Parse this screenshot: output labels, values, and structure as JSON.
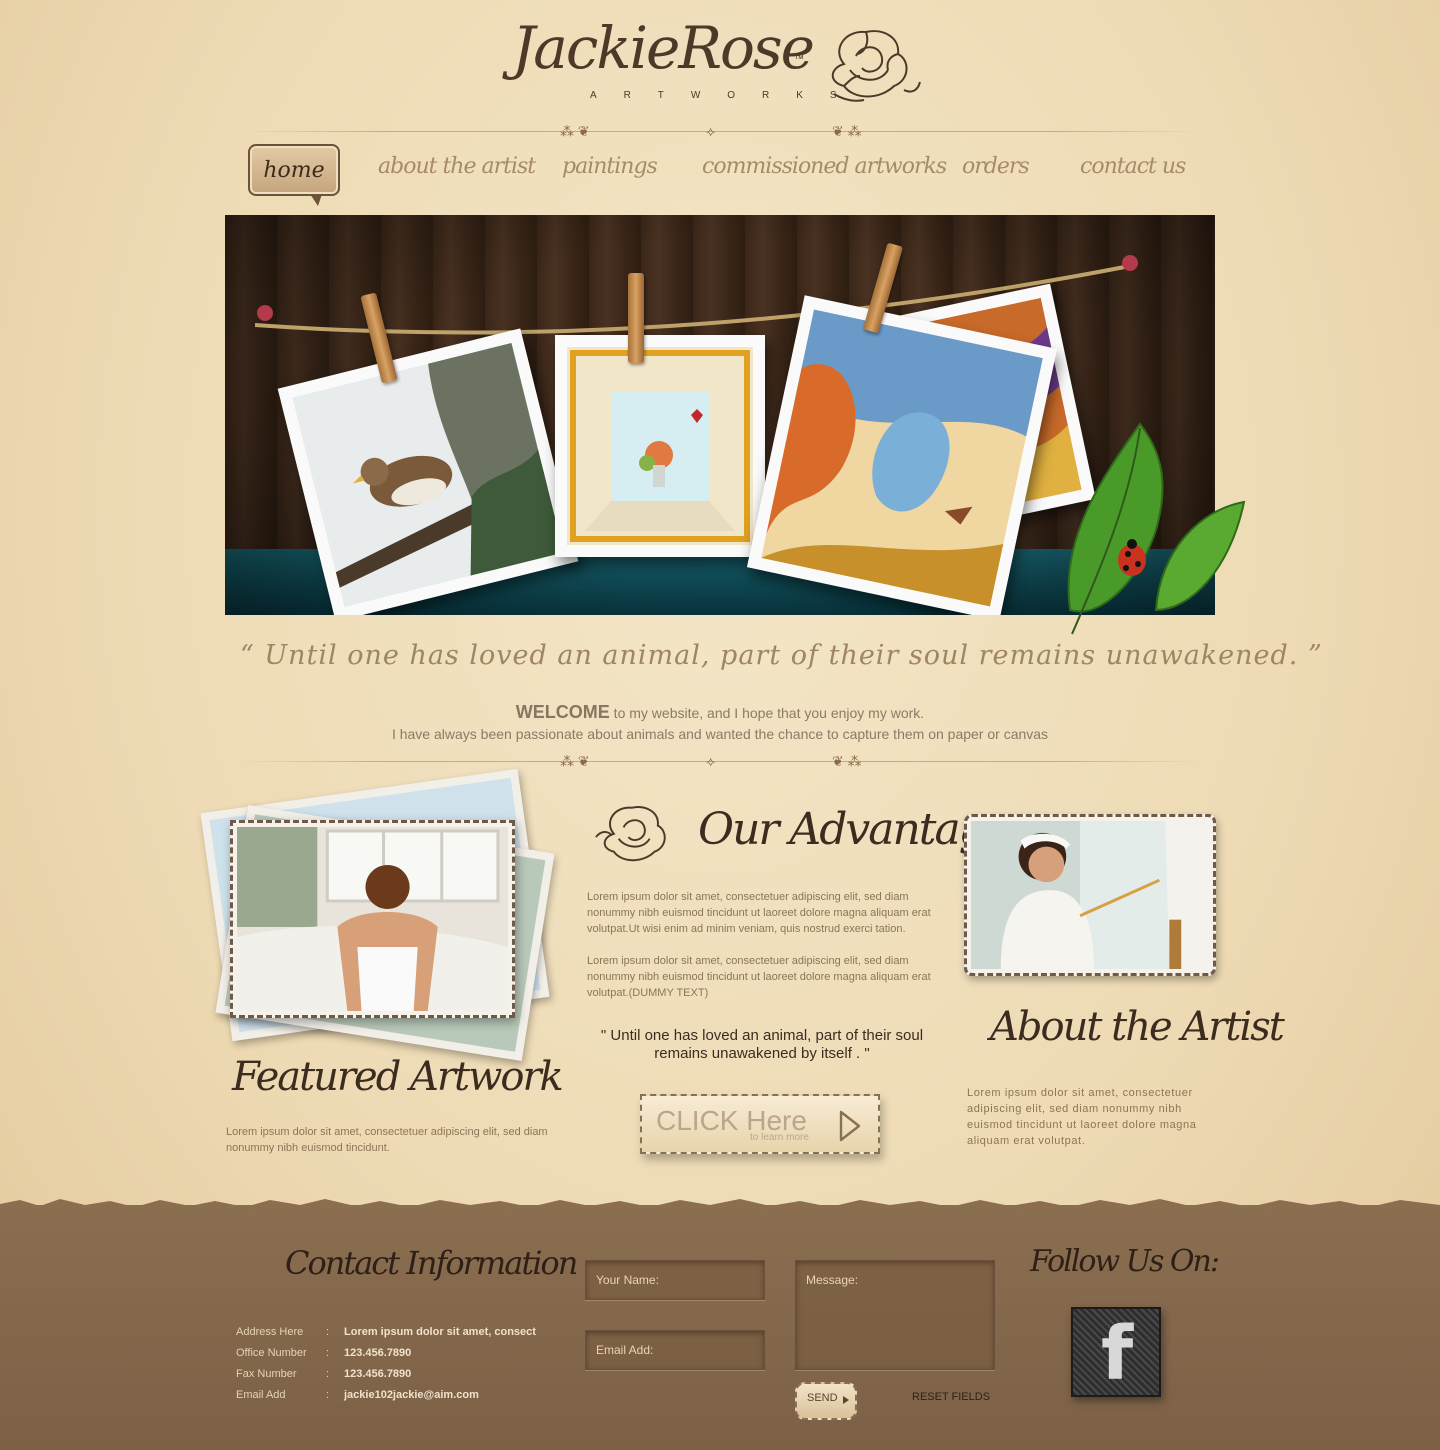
{
  "brand": {
    "name": "JackieRose",
    "tm": "™",
    "sub": "ARTWORKS"
  },
  "nav": {
    "items": [
      {
        "label": "home"
      },
      {
        "label": "about the artist"
      },
      {
        "label": "paintings"
      },
      {
        "label": "commissioned artworks"
      },
      {
        "label": "orders"
      },
      {
        "label": "contact us"
      }
    ]
  },
  "quote": "“ Until one has loved an animal, part of their soul remains unawakened. ”",
  "welcome": {
    "strong": "WELCOME",
    "line1": " to my website, and I hope that you enjoy my work.",
    "line2": "I have always been passionate about animals and wanted the chance to capture them on paper or canvas"
  },
  "featured": {
    "title": "Featured Artwork",
    "text": "Lorem ipsum dolor sit amet, consectetuer adipiscing elit, sed diam nonummy nibh euismod tincidunt."
  },
  "advantage": {
    "title": "Our Advantage",
    "para1": "Lorem ipsum dolor sit amet, consectetuer adipiscing elit, sed diam nonummy nibh euismod tincidunt ut laoreet dolore magna aliquam erat volutpat.Ut wisi enim ad minim veniam, quis nostrud exerci tation.",
    "para2": "Lorem ipsum dolor sit amet, consectetuer adipiscing elit, sed diam nonummy nibh euismod tincidunt ut laoreet dolore magna aliquam erat volutpat.(DUMMY TEXT)",
    "quote": "\" Until one has loved an animal, part of their soul remains unawakened by itself . \"",
    "cta_big": "CLICK Here",
    "cta_small": "to learn more"
  },
  "artist": {
    "title": "About the Artist",
    "text": "Lorem ipsum dolor sit amet, consectetuer adipiscing elit, sed diam nonummy nibh euismod tincidunt ut laoreet dolore magna aliquam erat volutpat."
  },
  "contact": {
    "title": "Contact Information",
    "rows": [
      {
        "label": "Address Here",
        "sep": ":",
        "value": "Lorem ipsum dolor sit amet, consect"
      },
      {
        "label": "Office Number",
        "sep": ":",
        "value": "123.456.7890"
      },
      {
        "label": "Fax Number",
        "sep": ":",
        "value": "123.456.7890"
      },
      {
        "label": "Email Add",
        "sep": ":",
        "value": "jackie102jackie@aim.com"
      }
    ]
  },
  "form": {
    "name_placeholder": "Your Name:",
    "email_placeholder": "Email Add:",
    "message_placeholder": "Message:",
    "send": "SEND",
    "reset": "RESET FIELDS"
  },
  "follow": {
    "title": "Follow Us On:",
    "facebook": "f"
  },
  "colors": {
    "background": "#eedbb5",
    "footer": "#7c6147",
    "ink": "#3c2c20",
    "accent": "#9e8566"
  },
  "icons": [
    "rose-icon",
    "divider-ornament-icon",
    "play-arrow-icon",
    "facebook-icon",
    "leaf-icon",
    "ladybug-icon",
    "clothespin-icon"
  ]
}
